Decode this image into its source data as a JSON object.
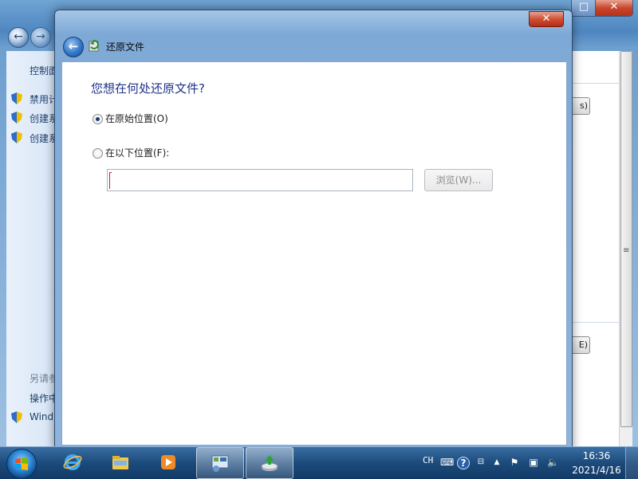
{
  "background_window": {
    "sidebar_items": [
      "控制面",
      "禁用计",
      "创建系",
      "创建系"
    ],
    "sidebar_bottom": [
      "另请参",
      "操作中",
      "Wind"
    ],
    "right_buttons": [
      "s)",
      "E)"
    ],
    "scroll_marker": "≡"
  },
  "dialog": {
    "title": "还原文件",
    "heading": "您想在何处还原文件?",
    "option_original": "在原始位置(O)",
    "option_original_checked": true,
    "option_other": "在以下位置(F):",
    "option_other_checked": false,
    "location_value": "",
    "browse_label": "浏览(W)...",
    "close_glyph": "✕"
  },
  "taskbar": {
    "input_lang": "CH",
    "clock_time": "16:36",
    "clock_date": "2021/4/16",
    "apps": [
      {
        "name": "internet-explorer-icon"
      },
      {
        "name": "file-explorer-icon"
      },
      {
        "name": "media-player-icon"
      },
      {
        "name": "control-panel-icon"
      },
      {
        "name": "backup-restore-icon"
      }
    ]
  },
  "colors": {
    "heading": "#1e3287",
    "dialog_frame": "#7ea9d6",
    "taskbar": "#1c4a7b",
    "close_red": "#cf4f34"
  }
}
